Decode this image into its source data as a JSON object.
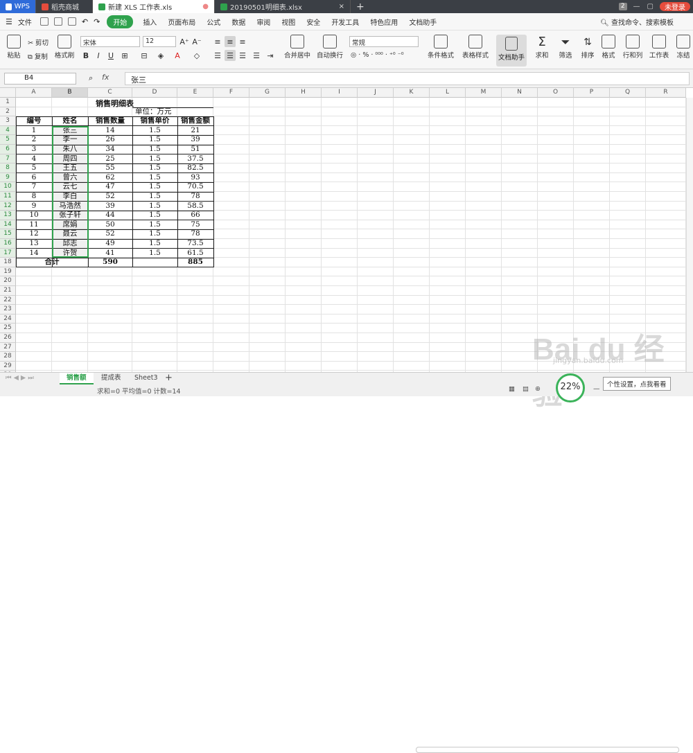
{
  "tabs": {
    "wps": "WPS",
    "shop": "稻壳商城",
    "active_file": "新建 XLS 工作表.xls",
    "other_file": "20190501明细表.xlsx",
    "count": "2",
    "login": "未登录"
  },
  "menu": {
    "file": "文件",
    "items": [
      "开始",
      "插入",
      "页面布局",
      "公式",
      "数据",
      "审阅",
      "视图",
      "安全",
      "开发工具",
      "特色应用",
      "文档助手"
    ],
    "search": "查找命令、搜索模板"
  },
  "ribbon": {
    "paste": "粘贴",
    "cut": "剪切",
    "copy": "复制",
    "format_painter": "格式刷",
    "font": "宋体",
    "size": "12",
    "merge": "合并居中",
    "wrap": "自动换行",
    "number_format": "常规",
    "cond_format": "条件格式",
    "table_style": "表格样式",
    "doc_assist": "文档助手",
    "sum": "求和",
    "filter": "筛选",
    "sort": "排序",
    "format": "格式",
    "rowcol": "行和列",
    "sheet": "工作表",
    "freeze": "冻结"
  },
  "formula_bar": {
    "cell_ref": "B4",
    "fx": "fx",
    "value": "张三"
  },
  "columns": [
    "A",
    "B",
    "C",
    "D",
    "E",
    "F",
    "G",
    "H",
    "I",
    "J",
    "K",
    "L",
    "M",
    "N",
    "O",
    "P",
    "Q",
    "R"
  ],
  "rows": [
    "1",
    "2",
    "3",
    "4",
    "5",
    "6",
    "7",
    "8",
    "9",
    "10",
    "11",
    "12",
    "13",
    "14",
    "15",
    "16",
    "17",
    "18",
    "19",
    "20",
    "21",
    "22",
    "23",
    "24",
    "25",
    "26",
    "27",
    "28",
    "29",
    "30"
  ],
  "sheet": {
    "title": "销售明细表",
    "unit": "单位：万元",
    "headers": [
      "编号",
      "姓名",
      "销售数量",
      "销售单价",
      "销售金额"
    ],
    "rows": [
      [
        "1",
        "张三",
        "14",
        "1.5",
        "21"
      ],
      [
        "2",
        "李一",
        "26",
        "1.5",
        "39"
      ],
      [
        "3",
        "朱八",
        "34",
        "1.5",
        "51"
      ],
      [
        "4",
        "周四",
        "25",
        "1.5",
        "37.5"
      ],
      [
        "5",
        "王五",
        "55",
        "1.5",
        "82.5"
      ],
      [
        "6",
        "曾六",
        "62",
        "1.5",
        "93"
      ],
      [
        "7",
        "云七",
        "47",
        "1.5",
        "70.5"
      ],
      [
        "8",
        "李白",
        "52",
        "1.5",
        "78"
      ],
      [
        "9",
        "马浩然",
        "39",
        "1.5",
        "58.5"
      ],
      [
        "10",
        "张子轩",
        "44",
        "1.5",
        "66"
      ],
      [
        "11",
        "席娟",
        "50",
        "1.5",
        "75"
      ],
      [
        "12",
        "聂云",
        "52",
        "1.5",
        "78"
      ],
      [
        "13",
        "邱志",
        "49",
        "1.5",
        "73.5"
      ],
      [
        "14",
        "许贺",
        "41",
        "1.5",
        "61.5"
      ]
    ],
    "total_label": "合计",
    "total_qty": "590",
    "total_amount": "885"
  },
  "sheet_tabs": [
    "销售额",
    "提成表",
    "Sheet3"
  ],
  "status": {
    "summary": "求和=0  平均值=0  计数=14",
    "zoom": "22%",
    "tooltip": "个性设置，点我看看"
  },
  "watermark": {
    "main": "Bai du 经验",
    "sub": "jingyan.baidu.com"
  }
}
